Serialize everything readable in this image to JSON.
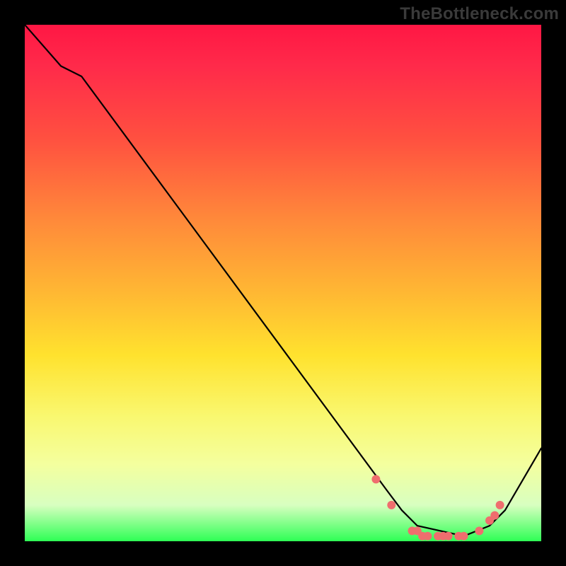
{
  "watermark": "TheBottleneck.com",
  "chart_data": {
    "type": "line",
    "title": "",
    "xlabel": "",
    "ylabel": "",
    "xlim": [
      0,
      100
    ],
    "ylim": [
      0,
      100
    ],
    "curve": {
      "x": [
        0,
        7,
        11,
        70,
        73,
        76,
        85,
        90,
        93,
        100
      ],
      "y": [
        100,
        92,
        90,
        10,
        6,
        3,
        1,
        3,
        6,
        18
      ]
    },
    "markers": {
      "x": [
        68,
        71,
        75,
        76,
        77,
        78,
        80,
        81,
        82,
        84,
        85,
        88,
        90,
        91,
        92
      ],
      "y": [
        12,
        7,
        2,
        2,
        1,
        1,
        1,
        1,
        1,
        1,
        1,
        2,
        4,
        5,
        7
      ]
    },
    "colors": {
      "line": "#000000",
      "marker": "#ef6e6e",
      "gradient_top": "#ff1744",
      "gradient_mid": "#ffe22e",
      "gradient_bottom": "#2eff55",
      "frame": "#000000"
    }
  }
}
